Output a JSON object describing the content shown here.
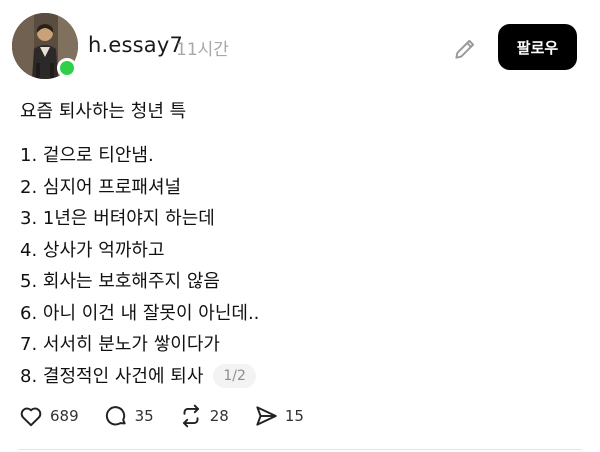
{
  "header": {
    "username": "h.essay7",
    "time": "11시간",
    "follow_label": "팔로우",
    "icons": {
      "edit": "pencil-icon",
      "online": "online-status-dot"
    },
    "colors": {
      "online": "#2fcf4a",
      "follow_bg": "#000000",
      "time": "#a8a8a8"
    }
  },
  "post": {
    "title": "요즘 퇴사하는 청년 특",
    "lines": [
      "1. 겉으로 티안냄.",
      "2. 심지어 프로패셔널",
      "3. 1년은 버텨야지 하는데",
      "4. 상사가 억까하고",
      "5. 회사는 보호해주지 않음",
      "6. 아니 이건 내 잘못이 아닌데..",
      "7. 서서히 분노가 쌓이다가",
      "8. 결정적인 사건에 퇴사"
    ],
    "page_indicator": "1/2"
  },
  "actions": {
    "like": {
      "icon": "heart-icon",
      "count": "689"
    },
    "comment": {
      "icon": "comment-icon",
      "count": "35"
    },
    "repost": {
      "icon": "repost-icon",
      "count": "28"
    },
    "share": {
      "icon": "send-icon",
      "count": "15"
    }
  }
}
